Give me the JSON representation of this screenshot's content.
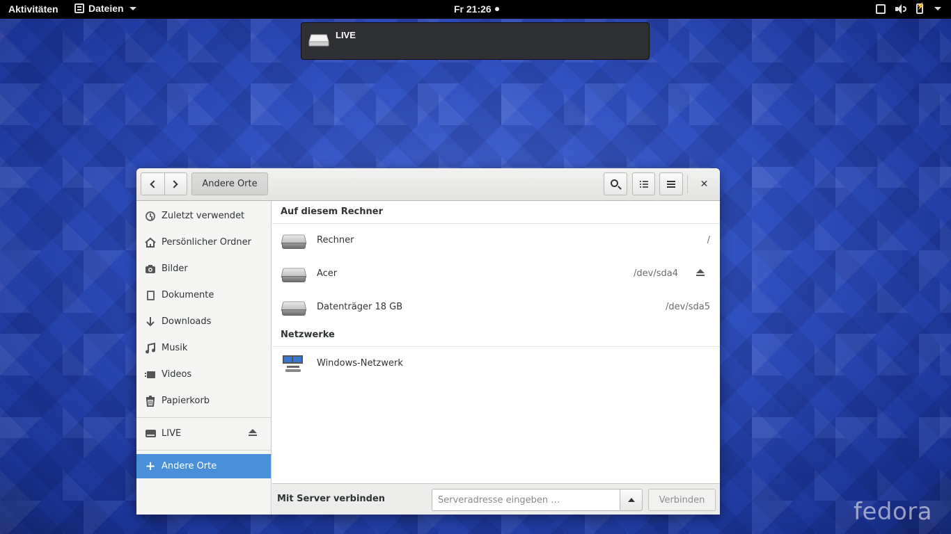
{
  "topbar": {
    "activities": "Aktivitäten",
    "app_menu": "Dateien",
    "clock": "Fr 21:26",
    "tray_icons": [
      "screen-icon",
      "volume-icon",
      "battery-icon",
      "system-menu-arrow-icon"
    ]
  },
  "notification": {
    "title": "LIVE",
    "icon": "drive-icon"
  },
  "window": {
    "path_button": "Andere Orte",
    "close_glyph": "✕"
  },
  "sidebar": {
    "items": [
      {
        "label": "Zuletzt verwendet",
        "icon": "clock-icon"
      },
      {
        "label": "Persönlicher Ordner",
        "icon": "home-icon"
      },
      {
        "label": "Bilder",
        "icon": "camera-icon"
      },
      {
        "label": "Dokumente",
        "icon": "document-icon"
      },
      {
        "label": "Downloads",
        "icon": "download-icon"
      },
      {
        "label": "Musik",
        "icon": "music-icon"
      },
      {
        "label": "Videos",
        "icon": "video-icon"
      },
      {
        "label": "Papierkorb",
        "icon": "trash-icon"
      }
    ],
    "devices": [
      {
        "label": "LIVE",
        "icon": "drive-icon"
      }
    ],
    "other": {
      "label": "Andere Orte",
      "icon": "plus-icon"
    }
  },
  "main": {
    "computer_section": "Auf diesem Rechner",
    "places": [
      {
        "name": "Rechner",
        "path": "/"
      },
      {
        "name": "Acer",
        "path": "/dev/sda4"
      },
      {
        "name": "Datenträger 18 GB",
        "path": "/dev/sda5"
      }
    ],
    "network_section": "Netzwerke",
    "networks": [
      {
        "name": "Windows-Netzwerk"
      }
    ]
  },
  "connect": {
    "label": "Mit Server verbinden",
    "placeholder": "Serveradresse eingeben …",
    "value": "",
    "button": "Verbinden"
  },
  "watermark": "fedora",
  "colors": {
    "accent": "#4a90d9",
    "topbar": "#000000",
    "notification_bg": "#2e3033"
  }
}
